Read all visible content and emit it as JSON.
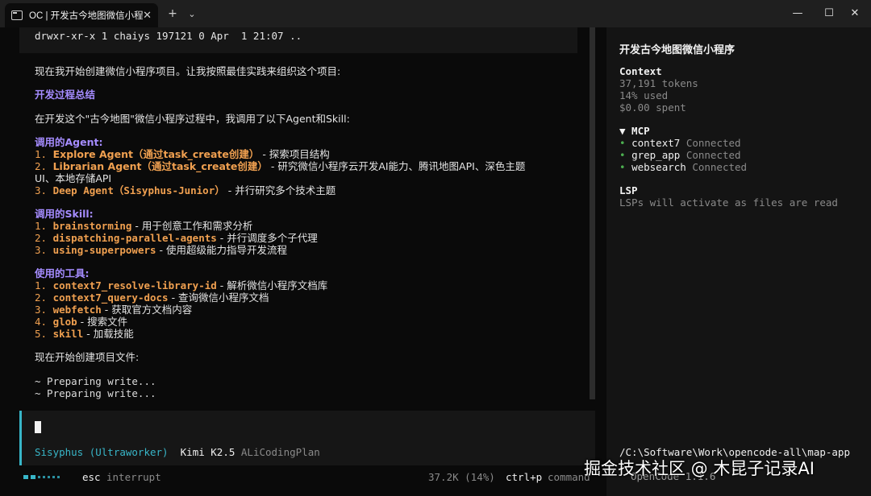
{
  "window": {
    "tab_title": "OC | 开发古今地图微信小程序",
    "icons": {
      "tab": "terminal-icon",
      "close": "close-icon",
      "new_tab": "plus-icon",
      "dropdown": "chevron-down-icon",
      "minimize": "minimize-icon",
      "maximize": "maximize-icon",
      "close_window": "close-icon"
    }
  },
  "main": {
    "command_output": "drwxr-xr-x 1 chaiys 197121 0 Apr  1 21:07 ..",
    "intro": "现在我开始创建微信小程序项目。让我按照最佳实践来组织这个项目:",
    "summary_heading": "开发过程总结",
    "summary_text": "在开发这个\"古今地图\"微信小程序过程中，我调用了以下Agent和Skill:",
    "agents_heading": "调用的Agent:",
    "agents": [
      {
        "num": "1.",
        "name": "Explore Agent（通过task_create创建）",
        "desc": " - 探索项目结构"
      },
      {
        "num": "2.",
        "name": "Librarian Agent（通过task_create创建）",
        "desc": " - 研究微信小程序云开发AI能力、腾讯地图API、深色主题"
      },
      {
        "num": "",
        "name": "",
        "desc": "UI、本地存储API"
      },
      {
        "num": "3.",
        "name": "Deep Agent（Sisyphus-Junior）",
        "desc": " - 并行研究多个技术主题"
      }
    ],
    "skills_heading": "调用的Skill:",
    "skills": [
      {
        "num": "1.",
        "name": "brainstorming",
        "desc": " - 用于创意工作和需求分析"
      },
      {
        "num": "2.",
        "name": "dispatching-parallel-agents",
        "desc": " - 并行调度多个子代理"
      },
      {
        "num": "3.",
        "name": "using-superpowers",
        "desc": " - 使用超级能力指导开发流程"
      }
    ],
    "tools_heading": "使用的工具:",
    "tools": [
      {
        "num": "1.",
        "name": "context7_resolve-library-id",
        "desc": " - 解析微信小程序文档库"
      },
      {
        "num": "2.",
        "name": "context7_query-docs",
        "desc": " - 查询微信小程序文档"
      },
      {
        "num": "3.",
        "name": "webfetch",
        "desc": " - 获取官方文档内容"
      },
      {
        "num": "4.",
        "name": "glob",
        "desc": " - 搜索文件"
      },
      {
        "num": "5.",
        "name": "skill",
        "desc": " - 加载技能"
      }
    ],
    "start_text": "现在开始创建项目文件:",
    "preparing": [
      "~ Preparing write...",
      "~ Preparing write..."
    ]
  },
  "input": {
    "agent": "Sisyphus (Ultraworker)",
    "model": "Kimi K2.5",
    "provider": "ALiCodingPlan"
  },
  "status": {
    "esc_key": "esc",
    "esc_label": "interrupt",
    "usage": "37.2K (14%)",
    "ctrl_key": "ctrl+p",
    "ctrl_label": "command"
  },
  "sidebar": {
    "title": "开发古今地图微信小程序",
    "context_heading": "Context",
    "tokens": "37,191 tokens",
    "used": "14% used",
    "spent": "$0.00 spent",
    "mcp_heading": "▼ MCP",
    "mcp": [
      {
        "name": "context7",
        "status": "Connected"
      },
      {
        "name": "grep_app",
        "status": "Connected"
      },
      {
        "name": "websearch",
        "status": "Connected"
      }
    ],
    "lsp_heading": "LSP",
    "lsp_text": "LSPs will activate as files are read",
    "path": "/C:\\Software\\Work\\opencode-all\\map-app",
    "footer": "OpenCode 1.1.6"
  },
  "watermark": "掘金技术社区 @ 木昆子记录AI",
  "colors": {
    "heading": "#a58cff",
    "highlight": "#f0a050",
    "accent": "#38b6c8",
    "connected": "#4caf50"
  }
}
